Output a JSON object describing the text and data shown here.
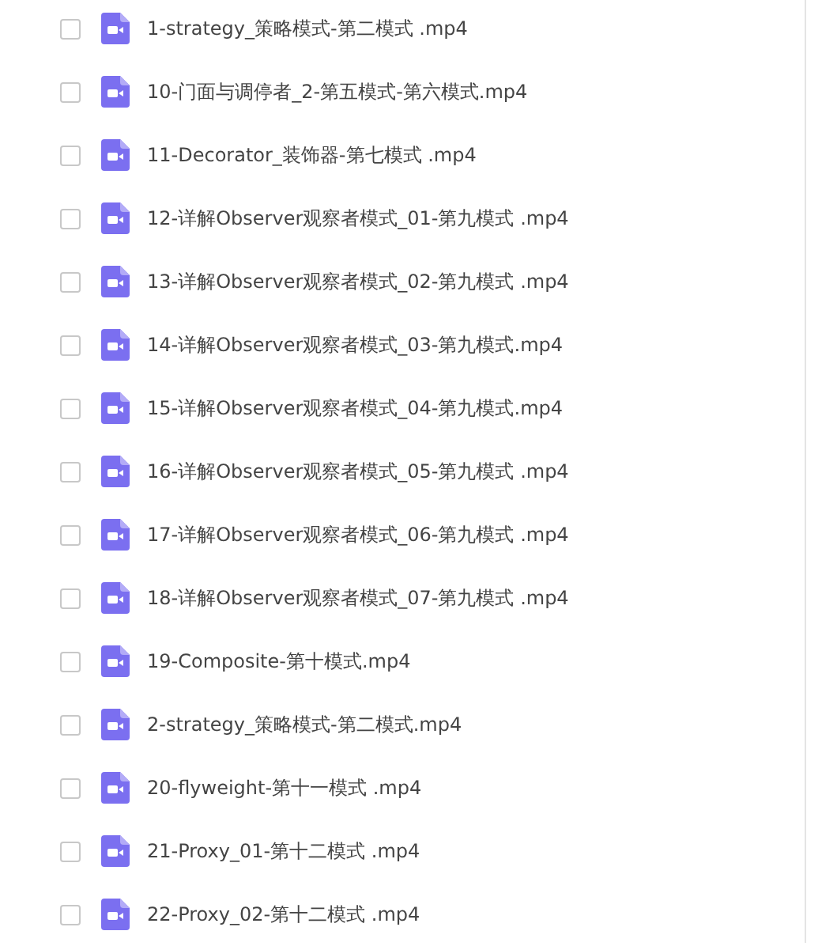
{
  "files": [
    {
      "name": "1-strategy_策略模式-第二模式 .mp4",
      "checked": false
    },
    {
      "name": "10-门面与调停者_2-第五模式-第六模式.mp4",
      "checked": false
    },
    {
      "name": "11-Decorator_装饰器-第七模式 .mp4",
      "checked": false
    },
    {
      "name": "12-详解Observer观察者模式_01-第九模式 .mp4",
      "checked": false
    },
    {
      "name": "13-详解Observer观察者模式_02-第九模式 .mp4",
      "checked": false
    },
    {
      "name": "14-详解Observer观察者模式_03-第九模式.mp4",
      "checked": false
    },
    {
      "name": "15-详解Observer观察者模式_04-第九模式.mp4",
      "checked": false
    },
    {
      "name": "16-详解Observer观察者模式_05-第九模式 .mp4",
      "checked": false
    },
    {
      "name": "17-详解Observer观察者模式_06-第九模式 .mp4",
      "checked": false
    },
    {
      "name": "18-详解Observer观察者模式_07-第九模式 .mp4",
      "checked": false
    },
    {
      "name": "19-Composite-第十模式.mp4",
      "checked": false
    },
    {
      "name": "2-strategy_策略模式-第二模式.mp4",
      "checked": false
    },
    {
      "name": "20-flyweight-第十一模式 .mp4",
      "checked": false
    },
    {
      "name": "21-Proxy_01-第十二模式 .mp4",
      "checked": false
    },
    {
      "name": "22-Proxy_02-第十二模式 .mp4",
      "checked": false
    }
  ]
}
